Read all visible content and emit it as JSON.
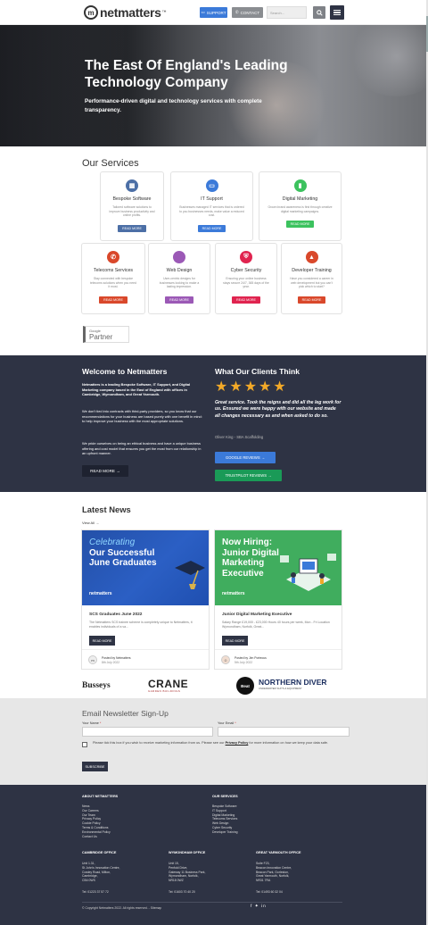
{
  "header": {
    "logo_text": "netmatters",
    "logo_mark": "m",
    "logo_tm": "™",
    "support_label": "SUPPORT",
    "contact_label": "CONTACT",
    "search_placeholder": "Search..."
  },
  "hero": {
    "title": "The East Of England's Leading Technology Company",
    "subtitle": "Performance-driven digital and technology services with complete transparency."
  },
  "services": {
    "title": "Our Services",
    "cards": [
      {
        "name": "Bespoke Software",
        "desc": "Tailored software solutions to improve business productivity and online profits.",
        "button": "READ MORE",
        "color": "#4c6fa6",
        "icon": "code-icon"
      },
      {
        "name": "IT Support",
        "desc": "Businesses managed IT services that is ordered to you businesses needs, make value a reduced cost.",
        "button": "READ MORE",
        "color": "#3b7ad9",
        "icon": "monitor-icon"
      },
      {
        "name": "Digital Marketing",
        "desc": "Grown brand awareness is first through creative digital marketing campaigns.",
        "button": "READ MORE",
        "color": "#3cc25e",
        "icon": "chart-icon"
      },
      {
        "name": "Telecoms Services",
        "desc": "Stay connected with bespoke telecoms solutions when you need it most.",
        "button": "READ MORE",
        "color": "#d9482b",
        "icon": "phone-icon"
      },
      {
        "name": "Web Design",
        "desc": "User-centric designs for businesses looking to make a lasting impression.",
        "button": "READ MORE",
        "color": "#9b59b6",
        "icon": "code-brackets-icon"
      },
      {
        "name": "Cyber Security",
        "desc": "Ensuring your online business stays secure 24/7, 365 days of the year.",
        "button": "READ MORE",
        "color": "#e0244f",
        "icon": "shield-icon"
      },
      {
        "name": "Developer Training",
        "desc": "Have you considered a career in web development but you can't pick which to start?",
        "button": "READ MORE",
        "color": "#d9482b",
        "icon": "graduation-icon"
      }
    ]
  },
  "google_partner": {
    "top": "Google",
    "bottom": "Partner"
  },
  "welcome": {
    "title": "Welcome to Netmatters",
    "p1": "Netmatters is a leading Bespoke Software, IT Support, and Digital Marketing company based in the East of England with offices in Cambridge, Wymondham, and Great Yarmouth.",
    "p2": "We don't tied into contracts with third-party providers, so you know that our recommendations for your business are based purely with one benefit in mind: to help improve your business with the most appropriate solutions.",
    "p3": "We pride ourselves on being an ethical business and have a unique business offering and cost model that ensures you get the most from our relationship in an upfront manner.",
    "button": "READ MORE"
  },
  "reviews": {
    "title": "What Our Clients Think",
    "stars": 5,
    "quote": "Great service. Took the reigns and did all the leg work for us. Ensured we were happy with our website and made all changes necessary as and when asked to do so.",
    "author": "Oliver King - SBA Scaffolding",
    "google_button": "GOOGLE REVIEWS",
    "trustpilot_button": "TRUSTPILOT REVIEWS"
  },
  "news": {
    "title": "Latest News",
    "view_all": "View All",
    "items": [
      {
        "image_line1": "Celebrating",
        "image_line2": "Our Successful June Graduates",
        "image_logo": "netmatters",
        "headline": "SCS Graduates June 2022",
        "desc": "The Netmatters SCS trainee scheme is completely unique to Netmatters, it enables individuals of a va...",
        "button": "READ MORE",
        "posted_by": "Posted by Netmatters",
        "date": "8th July 2022"
      },
      {
        "image_line1": "Now Hiring:",
        "image_line2": "Junior Digital Marketing Executive",
        "image_logo": "netmatters",
        "headline": "Junior Digital Marketing Executive",
        "desc": "Salary Range £19,000 - £23,000 Hours 40 hours per week, Mon - Fri Location Wymondham, Norfolk, Great...",
        "button": "READ MORE",
        "posted_by": "Posted by Jim Porteous",
        "date": "5th July 2022"
      }
    ]
  },
  "clients": [
    "Busseys",
    "CRANE",
    "GARDEN BUILDINGS",
    "Beat",
    "NORTHERN DIVER",
    "UNDERWATER SUITS & EQUIPMENT"
  ],
  "newsletter": {
    "title": "Email Newsletter Sign-Up",
    "name_label": "Your Name",
    "email_label": "Your Email",
    "required_mark": "*",
    "consent_text": "Please tick this box if you wish to receive marketing information from us. Please see our ",
    "privacy_link": "Privacy Policy",
    "consent_text_end": " for more information on how we keep your data safe.",
    "subscribe": "SUBSCRIBE"
  },
  "footer": {
    "about_title": "ABOUT NETMATTERS",
    "about_links": [
      "News",
      "Our Careers",
      "Our Team",
      "Privacy Policy",
      "Cookie Policy",
      "Terms & Conditions",
      "Environmental Policy",
      "Contact Us"
    ],
    "services_title": "OUR SERVICES",
    "service_links": [
      "Bespoke Software",
      "IT Support",
      "Digital Marketing",
      "Telecoms Services",
      "Web Design",
      "Cyber Security",
      "Developer Training"
    ],
    "offices": [
      {
        "title": "CAMBRIDGE OFFICE",
        "lines": [
          "Unit 1.31,",
          "St John's Innovation Centre,",
          "Cowley Road, Milton,",
          "Cambridge,",
          "CB4 0WS"
        ],
        "tel": "Tel: 01223 37 57 72"
      },
      {
        "title": "WYMONDHAM OFFICE",
        "lines": [
          "Unit 15,",
          "Penfold Drive,",
          "Gateway 11 Business Park,",
          "Wymondham, Norfolk,",
          "NR18 0WZ"
        ],
        "tel": "Tel: 01603 70 40 20"
      },
      {
        "title": "GREAT YARMOUTH OFFICE",
        "lines": [
          "Suite F23,",
          "Beacon Innovation Centre,",
          "Beacon Park, Gorleston,",
          "Great Yarmouth, Norfolk,",
          "NR31 7RA"
        ],
        "tel": "Tel: 01493 60 32 04"
      }
    ],
    "copyright": "© Copyright Netmatters 2022. All rights reserved. - Sitemap",
    "social": "f ✦ in"
  },
  "colors": {
    "dark_navy": "#2e3344",
    "support_blue": "#3b7ad9",
    "trustpilot_green": "#1a9a57",
    "star_gold": "#f2a928",
    "newsletter_bg": "#e7e7e7"
  }
}
